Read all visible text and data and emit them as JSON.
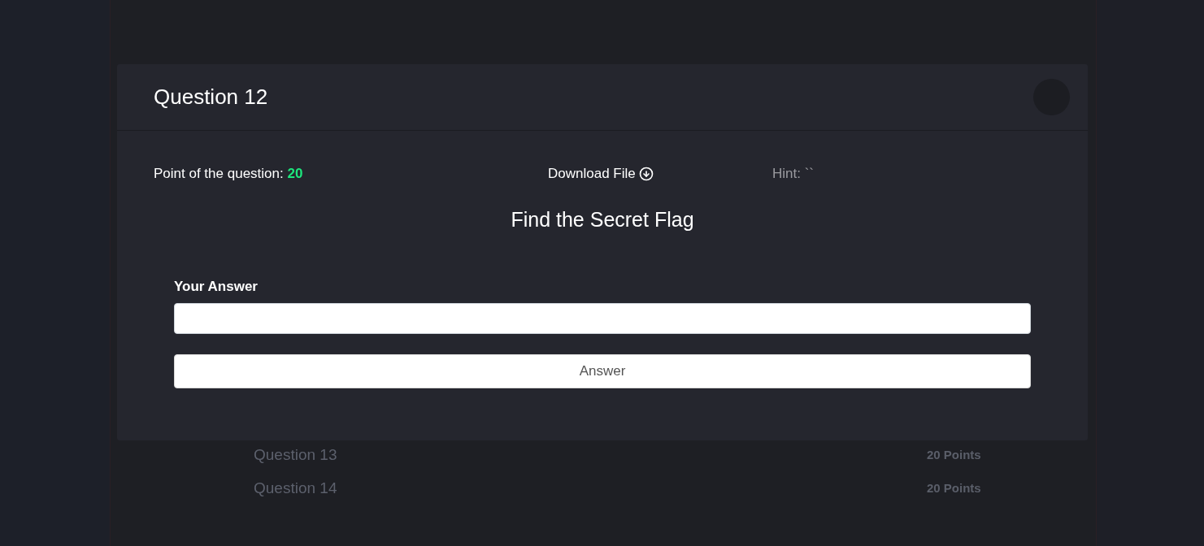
{
  "modal": {
    "title": "Question 12",
    "points_label": "Point of the question:",
    "points": "20",
    "download": "Download File",
    "hint": "Hint: ``",
    "question": "Find the Secret Flag",
    "answer_label": "Your Answer",
    "submit": "Answer"
  },
  "background_questions": [
    {
      "title": "Question 13",
      "points": "20 Points"
    },
    {
      "title": "Question 14",
      "points": "20 Points"
    }
  ]
}
